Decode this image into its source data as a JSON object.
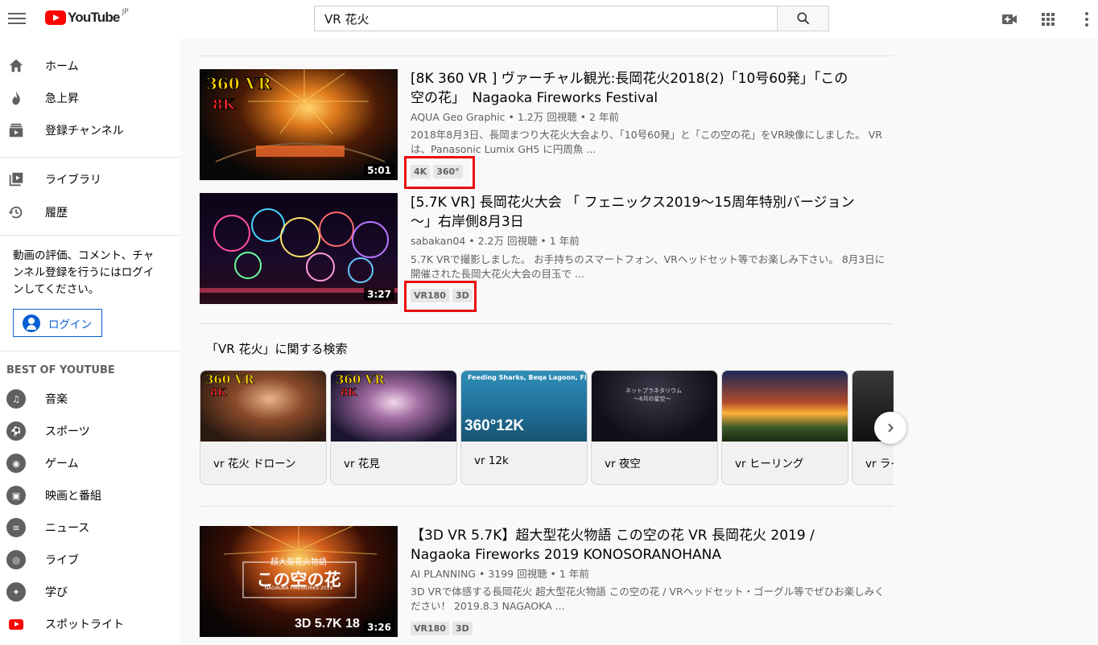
{
  "header": {
    "logo_text": "YouTube",
    "region": "JP",
    "search_query": "VR 花火"
  },
  "sidebar": {
    "main_items": [
      {
        "label": "ホーム",
        "icon": "home-icon"
      },
      {
        "label": "急上昇",
        "icon": "fire-icon"
      },
      {
        "label": "登録チャンネル",
        "icon": "subscriptions-icon"
      }
    ],
    "library_items": [
      {
        "label": "ライブラリ",
        "icon": "library-icon"
      },
      {
        "label": "履歴",
        "icon": "history-icon"
      }
    ],
    "signin_prompt": "動画の評価、コメント、チャンネル登録を行うにはログインしてください。",
    "signin_label": "ログイン",
    "best_title": "BEST OF YOUTUBE",
    "best_items": [
      {
        "label": "音楽",
        "icon": "music-icon"
      },
      {
        "label": "スポーツ",
        "icon": "sports-icon"
      },
      {
        "label": "ゲーム",
        "icon": "gaming-icon"
      },
      {
        "label": "映画と番組",
        "icon": "movies-icon"
      },
      {
        "label": "ニュース",
        "icon": "news-icon"
      },
      {
        "label": "ライブ",
        "icon": "live-icon"
      },
      {
        "label": "学び",
        "icon": "learning-icon"
      },
      {
        "label": "スポットライト",
        "icon": "spotlight-icon"
      }
    ]
  },
  "videos": [
    {
      "title": "[8K 360 VR ] ヴァーチャル観光:長岡花火2018(2)「10号60発」「この空の花」　Nagaoka Fireworks Festival",
      "meta": "AQUA Geo Graphic • 1.2万 回視聴 • 2 年前",
      "desc": "2018年8月3日、長岡まつり大花火大会より、「10号60発」と「この空の花」をVR映像にしました。 VRは、Panasonic Lumix GH5 に円周魚 ...",
      "duration": "5:01",
      "thumb_text_1": "360 VR",
      "thumb_text_2": "8K",
      "badges": [
        "4K",
        "360°"
      ]
    },
    {
      "title": "[5.7K VR] 長岡花火大会 「 フェニックス2019～15周年特別バージョン～」右岸側8月3日",
      "meta": "sabakan04 • 2.2万 回視聴 • 1 年前",
      "desc": "5.7K VRで撮影しました。 お手持ちのスマートフォン、VRヘッドセット等でお楽しみ下さい。 8月3日に開催された長岡大花火大会の目玉で ...",
      "duration": "3:27",
      "badges": [
        "VR180",
        "3D"
      ]
    },
    {
      "title": "【3D VR 5.7K】超大型花火物語 この空の花 VR 長岡花火 2019 / Nagaoka Fireworks 2019 KONOSORANOHANA",
      "meta": "AI PLANNING • 3199 回視聴 • 1 年前",
      "desc": "3D VRで体感する長岡花火 超大型花火物語 この空の花 / VRヘッドセット・ゴーグル等でぜひお楽しみください！ 2019.8.3 NAGAOKA ...",
      "duration": "3:26",
      "thumb_small": "超大型花火物語",
      "thumb_big": "この空の花",
      "thumb_sub": "NAGAOKA FIREWORKS 2019",
      "thumb_corner": "3D 5.7K 18",
      "badges": [
        "VR180",
        "3D"
      ]
    }
  ],
  "related": {
    "title": "「VR 花火」に関する検索",
    "cards": [
      {
        "label": "vr 花火 ドローン",
        "overlay_1": "360 VR",
        "overlay_2": "8K"
      },
      {
        "label": "vr 花見",
        "overlay_1": "360 VR",
        "overlay_2": "8K"
      },
      {
        "label": "vr 12k",
        "overlay_1": "Feeding Sharks, Beqa Lagoon, Fiji",
        "overlay_2": "360°12K"
      },
      {
        "label": "vr 夜空",
        "overlay_1": "ネットプラネタリウム",
        "overlay_2": "～6月の星空～"
      },
      {
        "label": "vr ヒーリング"
      },
      {
        "label": "vr ライ"
      }
    ]
  },
  "colors": {
    "brand": "#ff0000",
    "accent": "#065fd4",
    "highlight_box": "#ea0f0f"
  }
}
